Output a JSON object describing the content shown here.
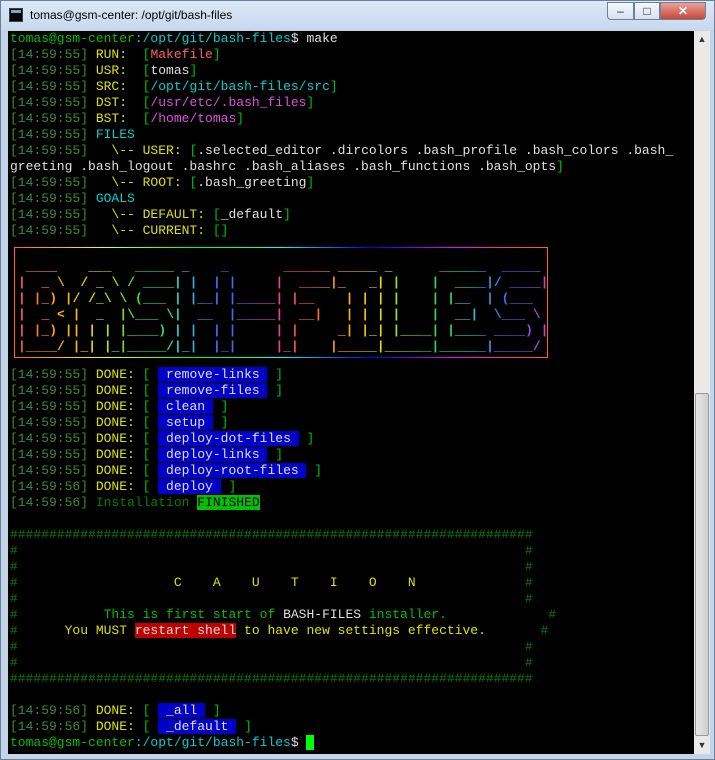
{
  "window": {
    "title": "tomas@gsm-center: /opt/git/bash-files"
  },
  "prompt": {
    "user_host": "tomas@gsm-center",
    "path": ":/opt/git/bash-files",
    "sign": "$ ",
    "command": "make"
  },
  "logo_art": [
    " ____    ___   _____ _    _       ______ _____ _      ______  _____",
    "|  _ \\  / _ \\ / ____| |  | |     |  ____|_   _| |    |  ____|/ ____|",
    "| |_) |/ /_\\ \\ (___ | |__| |_____| |__    | | | |    | |__  | (___",
    "|  _ < |  _  |\\___ \\|  __  |_____|  __|   | | | |    |  __|  \\___ \\",
    "| |_) || | | |____) | |  | |     | |     _| |_| |____| |____ ____) |",
    "|____/ |_| |_|_____/|_|  |_|     |_|    |_____|______|______|_____/"
  ],
  "lines": [
    [
      [
        "g",
        "tomas@gsm-center"
      ],
      [
        "c",
        ":/opt/git/bash-files"
      ],
      [
        "w",
        "$ make"
      ]
    ],
    [
      [
        "ts",
        "[14:59:55] "
      ],
      [
        "y",
        "RUN:  "
      ],
      [
        "g",
        "["
      ],
      [
        "r",
        "Makefile"
      ],
      [
        "g",
        "]"
      ]
    ],
    [
      [
        "ts",
        "[14:59:55] "
      ],
      [
        "y",
        "USR:  "
      ],
      [
        "g",
        "["
      ],
      [
        "w",
        "tomas"
      ],
      [
        "g",
        "]"
      ]
    ],
    [
      [
        "ts",
        "[14:59:55] "
      ],
      [
        "y",
        "SRC:  "
      ],
      [
        "g",
        "["
      ],
      [
        "c",
        "/opt/git/bash-files/src"
      ],
      [
        "g",
        "]"
      ]
    ],
    [
      [
        "ts",
        "[14:59:55] "
      ],
      [
        "y",
        "DST:  "
      ],
      [
        "g",
        "["
      ],
      [
        "m",
        "/usr/etc/.bash_files"
      ],
      [
        "g",
        "]"
      ]
    ],
    [
      [
        "ts",
        "[14:59:55] "
      ],
      [
        "y",
        "BST:  "
      ],
      [
        "g",
        "["
      ],
      [
        "m",
        "/home/tomas"
      ],
      [
        "g",
        "]"
      ]
    ],
    [
      [
        "ts",
        "[14:59:55] "
      ],
      [
        "c",
        "FILES"
      ]
    ],
    [
      [
        "ts",
        "[14:59:55]   "
      ],
      [
        "y",
        "\\-- USER: "
      ],
      [
        "g",
        "["
      ],
      [
        "w",
        ".selected_editor .dircolors .bash_profile .bash_colors .bash_"
      ]
    ],
    [
      [
        "w",
        "greeting .bash_logout .bashrc .bash_aliases .bash_functions .bash_opts"
      ],
      [
        "g",
        "]"
      ]
    ],
    [
      [
        "ts",
        "[14:59:55]   "
      ],
      [
        "y",
        "\\-- ROOT: "
      ],
      [
        "g",
        "["
      ],
      [
        "w",
        ".bash_greeting"
      ],
      [
        "g",
        "]"
      ]
    ],
    [
      [
        "ts",
        "[14:59:55] "
      ],
      [
        "c",
        "GOALS"
      ]
    ],
    [
      [
        "ts",
        "[14:59:55]   "
      ],
      [
        "y",
        "\\-- DEFAULT: "
      ],
      [
        "g",
        "["
      ],
      [
        "w",
        "_default"
      ],
      [
        "g",
        "]"
      ]
    ],
    [
      [
        "ts",
        "[14:59:55]   "
      ],
      [
        "y",
        "\\-- CURRENT: "
      ],
      [
        "g",
        "[]"
      ]
    ],
    [],
    [],
    [],
    [],
    [],
    [],
    [],
    [],
    [
      [
        "ts",
        "[14:59:55] "
      ],
      [
        "y",
        "DONE: "
      ],
      [
        "g",
        "[ "
      ],
      [
        "bbg",
        " remove-links "
      ],
      [
        "g",
        " ]"
      ]
    ],
    [
      [
        "ts",
        "[14:59:55] "
      ],
      [
        "y",
        "DONE: "
      ],
      [
        "g",
        "[ "
      ],
      [
        "bbg",
        " remove-files "
      ],
      [
        "g",
        " ]"
      ]
    ],
    [
      [
        "ts",
        "[14:59:55] "
      ],
      [
        "y",
        "DONE: "
      ],
      [
        "g",
        "[ "
      ],
      [
        "bbg",
        " clean "
      ],
      [
        "g",
        " ]"
      ]
    ],
    [
      [
        "ts",
        "[14:59:55] "
      ],
      [
        "y",
        "DONE: "
      ],
      [
        "g",
        "[ "
      ],
      [
        "bbg",
        " setup "
      ],
      [
        "g",
        " ]"
      ]
    ],
    [
      [
        "ts",
        "[14:59:55] "
      ],
      [
        "y",
        "DONE: "
      ],
      [
        "g",
        "[ "
      ],
      [
        "bbg",
        " deploy-dot-files "
      ],
      [
        "g",
        " ]"
      ]
    ],
    [
      [
        "ts",
        "[14:59:55] "
      ],
      [
        "y",
        "DONE: "
      ],
      [
        "g",
        "[ "
      ],
      [
        "bbg",
        " deploy-links "
      ],
      [
        "g",
        " ]"
      ]
    ],
    [
      [
        "ts",
        "[14:59:55] "
      ],
      [
        "y",
        "DONE: "
      ],
      [
        "g",
        "[ "
      ],
      [
        "bbg",
        " deploy-root-files "
      ],
      [
        "g",
        " ]"
      ]
    ],
    [
      [
        "ts",
        "[14:59:56] "
      ],
      [
        "y",
        "DONE: "
      ],
      [
        "g",
        "[ "
      ],
      [
        "bbg",
        " deploy "
      ],
      [
        "g",
        " ]"
      ]
    ],
    [
      [
        "ts",
        "[14:59:56] "
      ],
      [
        "dg",
        "Installation "
      ],
      [
        "gbg",
        "FINISHED"
      ]
    ],
    [],
    [
      [
        "dg",
        "###################################################################"
      ]
    ],
    [
      [
        "dg",
        "#                                                                 #"
      ]
    ],
    [
      [
        "dg",
        "#                                                                 #"
      ]
    ],
    [
      [
        "dg",
        "#                    "
      ],
      [
        "y",
        "C    A    U    T    I    O    N"
      ],
      [
        "dg",
        "              #"
      ]
    ],
    [
      [
        "dg",
        "#                                                                 #"
      ]
    ],
    [
      [
        "dg",
        "#           "
      ],
      [
        "g",
        "This is first start of "
      ],
      [
        "w",
        "BASH-FILES"
      ],
      [
        "g",
        " installer."
      ],
      [
        "dg",
        "             #"
      ]
    ],
    [
      [
        "dg",
        "#      "
      ],
      [
        "y",
        "You MUST "
      ],
      [
        "rbg",
        "restart shell"
      ],
      [
        "y",
        " to have new settings effective."
      ],
      [
        "dg",
        "       #"
      ]
    ],
    [
      [
        "dg",
        "#                                                                 #"
      ]
    ],
    [
      [
        "dg",
        "#                                                                 #"
      ]
    ],
    [
      [
        "dg",
        "###################################################################"
      ]
    ],
    [],
    [
      [
        "ts",
        "[14:59:56] "
      ],
      [
        "y",
        "DONE: "
      ],
      [
        "g",
        "[ "
      ],
      [
        "bbg",
        " _all "
      ],
      [
        "g",
        " ]"
      ]
    ],
    [
      [
        "ts",
        "[14:59:56] "
      ],
      [
        "y",
        "DONE: "
      ],
      [
        "g",
        "[ "
      ],
      [
        "bbg",
        " _default "
      ],
      [
        "g",
        " ]"
      ]
    ],
    [
      [
        "g",
        "tomas@gsm-center"
      ],
      [
        "c",
        ":/opt/git/bash-files"
      ],
      [
        "w",
        "$ "
      ],
      [
        "cursor",
        " "
      ]
    ]
  ]
}
